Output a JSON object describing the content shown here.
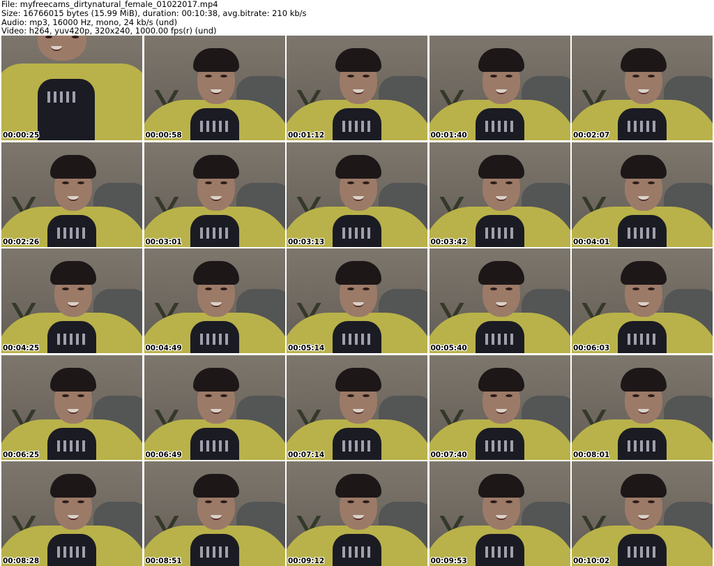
{
  "header": {
    "file_line": "File: myfreecams_dirtynatural_female_01022017.mp4",
    "size_line": "Size: 16766015 bytes (15.99 MiB), duration: 00:10:38, avg.bitrate: 210 kb/s",
    "audio_line": "Audio: mp3, 16000 Hz, mono, 24 kb/s (und)",
    "video_line": "Video: h264, yuv420p, 320x240, 1000.00 fps(r) (und)"
  },
  "thumbnails": [
    {
      "timestamp": "00:00:25"
    },
    {
      "timestamp": "00:00:58"
    },
    {
      "timestamp": "00:01:12"
    },
    {
      "timestamp": "00:01:40"
    },
    {
      "timestamp": "00:02:07"
    },
    {
      "timestamp": "00:02:26"
    },
    {
      "timestamp": "00:03:01"
    },
    {
      "timestamp": "00:03:13"
    },
    {
      "timestamp": "00:03:42"
    },
    {
      "timestamp": "00:04:01"
    },
    {
      "timestamp": "00:04:25"
    },
    {
      "timestamp": "00:04:49"
    },
    {
      "timestamp": "00:05:14"
    },
    {
      "timestamp": "00:05:40"
    },
    {
      "timestamp": "00:06:03"
    },
    {
      "timestamp": "00:06:25"
    },
    {
      "timestamp": "00:06:49"
    },
    {
      "timestamp": "00:07:14"
    },
    {
      "timestamp": "00:07:40"
    },
    {
      "timestamp": "00:08:01"
    },
    {
      "timestamp": "00:08:28"
    },
    {
      "timestamp": "00:08:51"
    },
    {
      "timestamp": "00:09:12"
    },
    {
      "timestamp": "00:09:53"
    },
    {
      "timestamp": "00:10:02"
    }
  ]
}
